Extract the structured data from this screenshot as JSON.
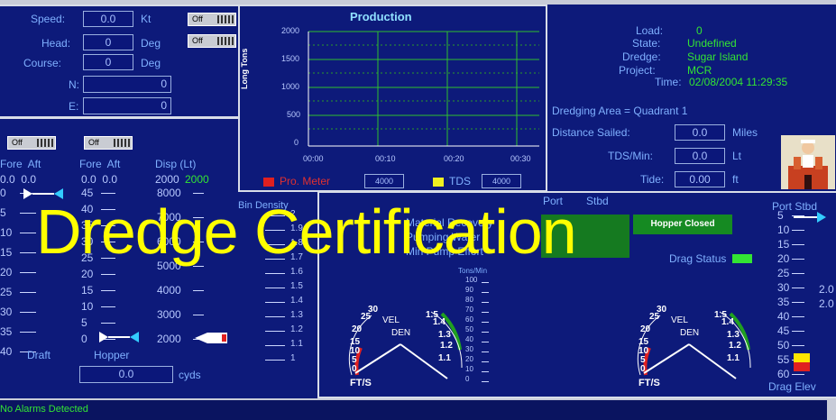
{
  "speed": {
    "label": "Speed:",
    "value": "0.0",
    "unit": "Kt",
    "toggle": "Off"
  },
  "head": {
    "label": "Head:",
    "value": "0",
    "unit": "Deg",
    "toggle": "Off"
  },
  "course": {
    "label": "Course:",
    "value": "0",
    "unit": "Deg"
  },
  "n": {
    "label": "N:",
    "value": "0"
  },
  "e": {
    "label": "E:",
    "value": "0"
  },
  "production": {
    "title": "Production",
    "ylabel": "Long Tons",
    "yticks": [
      "2000",
      "1500",
      "1000",
      "500",
      "0"
    ],
    "xticks": [
      "00:00",
      "00:10",
      "00:20",
      "00:30"
    ],
    "legend_meter": "Pro. Meter",
    "meter_value": "4000",
    "legend_tds": "TDS",
    "tds_value": "4000"
  },
  "info": {
    "load_label": "Load:",
    "load_value": "0",
    "state_label": "State:",
    "state_value": "Undefined",
    "dredge_label": "Dredge:",
    "dredge_value": "Sugar Island",
    "project_label": "Project:",
    "project_value": "MCR",
    "time_label": "Time:",
    "time_value": "02/08/2004 11:29:35",
    "area": "Dredging Area = Quadrant 1",
    "distance_label": "Distance Sailed:",
    "distance_value": "0.0",
    "distance_unit": "Miles",
    "tds_label": "TDS/Min:",
    "tds_value": "0.0",
    "tds_unit": "Lt",
    "tide_label": "Tide:",
    "tide_value": "0.00",
    "tide_unit": "ft"
  },
  "draft_section": {
    "toggle1": "Off",
    "toggle2": "Off",
    "fore_aft_1": "Fore  Aft",
    "fore_aft_2": "Fore  Aft",
    "disp": "Disp (Lt)",
    "vals1": "0.0  0.0",
    "vals2": "0.0  0.0",
    "disp_a": "2000",
    "disp_b": "2000",
    "draft_ticks": [
      "0",
      "5",
      "10",
      "15",
      "20",
      "25",
      "30",
      "35",
      "40"
    ],
    "hopper_ticks": [
      "45",
      "40",
      "35",
      "30",
      "25",
      "20",
      "15",
      "10",
      "5",
      "0"
    ],
    "disp_ticks": [
      "8000",
      "7000",
      "6000",
      "5000",
      "4000",
      "3000",
      "2000"
    ],
    "draft_label": "Draft",
    "hopper_label": "Hopper",
    "cyds_value": "0.0",
    "cyds_unit": "cyds",
    "bin_density": "Bin Density",
    "bin_ticks": [
      "2",
      "1.9",
      "1.8",
      "1.7",
      "1.6",
      "1.5",
      "1.4",
      "1.3",
      "1.2",
      "1.1",
      "1"
    ]
  },
  "pump": {
    "port": "Port",
    "stbd": "Stbd",
    "material_recovery": "Material Recovery",
    "pumping_water": "Pumping Water",
    "min_pump_effort": "Min Pump Effort",
    "hopper_closed": "Hopper Closed",
    "drag_status": "Drag Status",
    "tons_label": "Tons/Min",
    "tons_ticks": [
      "100",
      "90",
      "80",
      "70",
      "60",
      "50",
      "40",
      "30",
      "20",
      "10",
      "0"
    ],
    "vel": "VEL",
    "den": "DEN",
    "fts": "FT/S",
    "vel_ticks": [
      "30",
      "25",
      "20",
      "15",
      "10",
      "5",
      "0"
    ],
    "den_ticks": [
      "1.5",
      "1.4",
      "1.3",
      "1.2",
      "1.1"
    ]
  },
  "drag_elev": {
    "label": "Port Stbd",
    "title": "Drag Elev",
    "ticks": [
      "5",
      "10",
      "15",
      "20",
      "25",
      "30",
      "35",
      "40",
      "45",
      "50",
      "55",
      "60"
    ],
    "side_vals": [
      "2.0",
      "2.0"
    ]
  },
  "watermark": "Dredge Certification",
  "status_bar": "No Alarms Detected",
  "colors": {
    "bg": "#0d1a7a",
    "accent_green": "#33e533",
    "watermark": "#ffff00"
  }
}
